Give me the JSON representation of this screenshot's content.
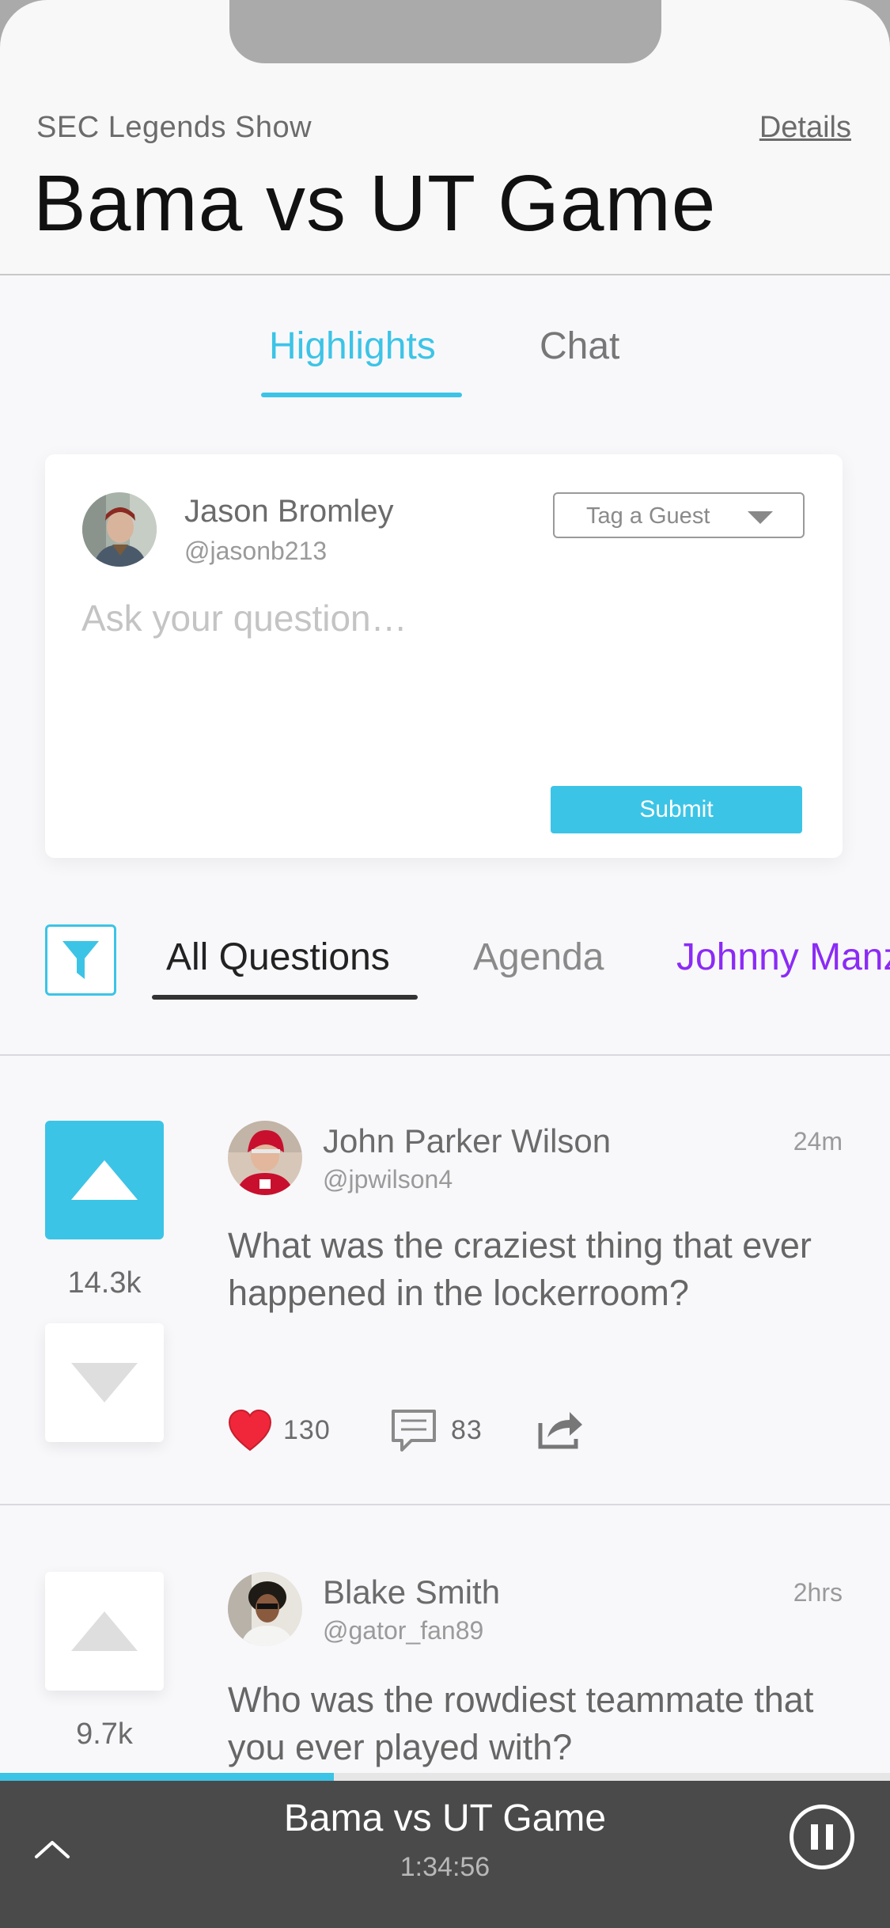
{
  "header": {
    "show_name": "SEC Legends Show",
    "details_label": "Details",
    "title": "Bama vs UT Game"
  },
  "tabs": [
    {
      "label": "Highlights",
      "active": true
    },
    {
      "label": "Chat",
      "active": false
    }
  ],
  "composer": {
    "user_name": "Jason Bromley",
    "user_handle": "@jasonb213",
    "tag_placeholder": "Tag a Guest",
    "question_placeholder": "Ask your question…",
    "question_value": "",
    "submit_label": "Submit"
  },
  "filter_tabs": [
    {
      "label": "All Questions",
      "active": true
    },
    {
      "label": "Agenda",
      "active": false
    },
    {
      "label": "Johnny Manziel",
      "active": false
    }
  ],
  "posts": [
    {
      "author": "John Parker Wilson",
      "handle": "@jpwilson4",
      "time": "24m",
      "text": "What was the craziest thing that ever happened in the lockerroom?",
      "votes": "14.3k",
      "upvoted": true,
      "likes": "130",
      "comments": "83"
    },
    {
      "author": "Blake Smith",
      "handle": "@gator_fan89",
      "time": "2hrs",
      "text": "Who was the rowdiest teammate that you ever played with?",
      "votes": "9.7k",
      "upvoted": false
    }
  ],
  "player": {
    "title": "Bama vs UT Game",
    "elapsed": "1:34:56",
    "progress": 0.375
  },
  "colors": {
    "accent": "#3cc4e6",
    "purple": "#8b2bf5",
    "heart": "#f0273a",
    "player_bg": "#4a4a4a"
  },
  "icons": [
    "filter-icon",
    "triangle-up-icon",
    "triangle-down-icon",
    "heart-icon",
    "comment-icon",
    "share-icon",
    "chevron-up-icon",
    "pause-icon",
    "caret-down-icon"
  ]
}
